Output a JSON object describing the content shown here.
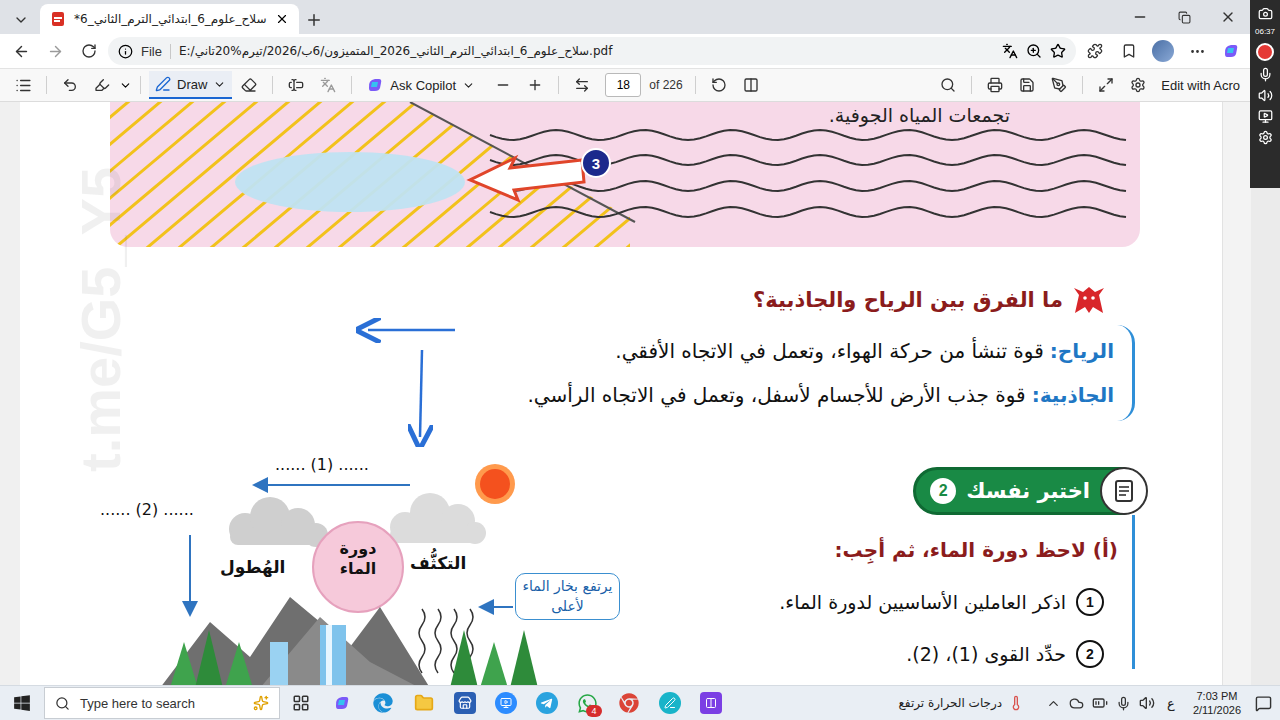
{
  "browser": {
    "tab": {
      "title": "*سلاح_علوم_6_ابتدائي_الترم_الثاني_6",
      "selected": true
    },
    "address": {
      "scheme": "File",
      "url": "E:/سلاح_علوم_6_ابتدائي_الترم_الثاني_2026_المتميزون/6ب/2026/تيرم%20تاني.pdf"
    }
  },
  "pdf_toolbar": {
    "draw": "Draw",
    "draw_selected": true,
    "copilot": "Ask Copilot",
    "page": "18",
    "page_count": "of 226",
    "edit": "Edit with Acro"
  },
  "recorder": {
    "time": "06:37",
    "recording": true
  },
  "page": {
    "watermark": "t.me/G5_Y5",
    "top_caption": "تجمعات المياه الجوفية.",
    "callout_number": "3",
    "question_title": "ما الفرق بين الرياح والجاذبية؟",
    "definitions": [
      {
        "term": "الرياح:",
        "text": "قوة تنشأ من حركة الهواء، وتعمل في الاتجاه الأفقي."
      },
      {
        "term": "الجاذبية:",
        "text": "قوة جذب الأرض للأجسام لأسفل، وتعمل في الاتجاه الرأسي."
      }
    ],
    "test_badge": {
      "label": "اختبر نفسك",
      "number": "2"
    },
    "part_label": "(أ) لاحظ دورة الماء، ثم أجِب:",
    "questions": [
      {
        "number": "1",
        "text": "اذكر العاملين الأساسيين لدورة الماء."
      },
      {
        "number": "2",
        "text": "حدِّد القوى (1)، (2)."
      }
    ],
    "diagram": {
      "center": "دورة الماء",
      "condensation": "التكثُّف",
      "precipitation": "الهُطول",
      "rising": "يرتفع بخار الماء لأعلى",
      "force_1": "...... (1) ......",
      "force_2": "...... (2) ......"
    }
  },
  "taskbar": {
    "search_placeholder": "Type here to search",
    "whatsapp_badge": "4",
    "weather": "درجات الحرارة ترتفع",
    "language": "ع",
    "time": "7:03 PM",
    "date": "2/11/2026"
  }
}
